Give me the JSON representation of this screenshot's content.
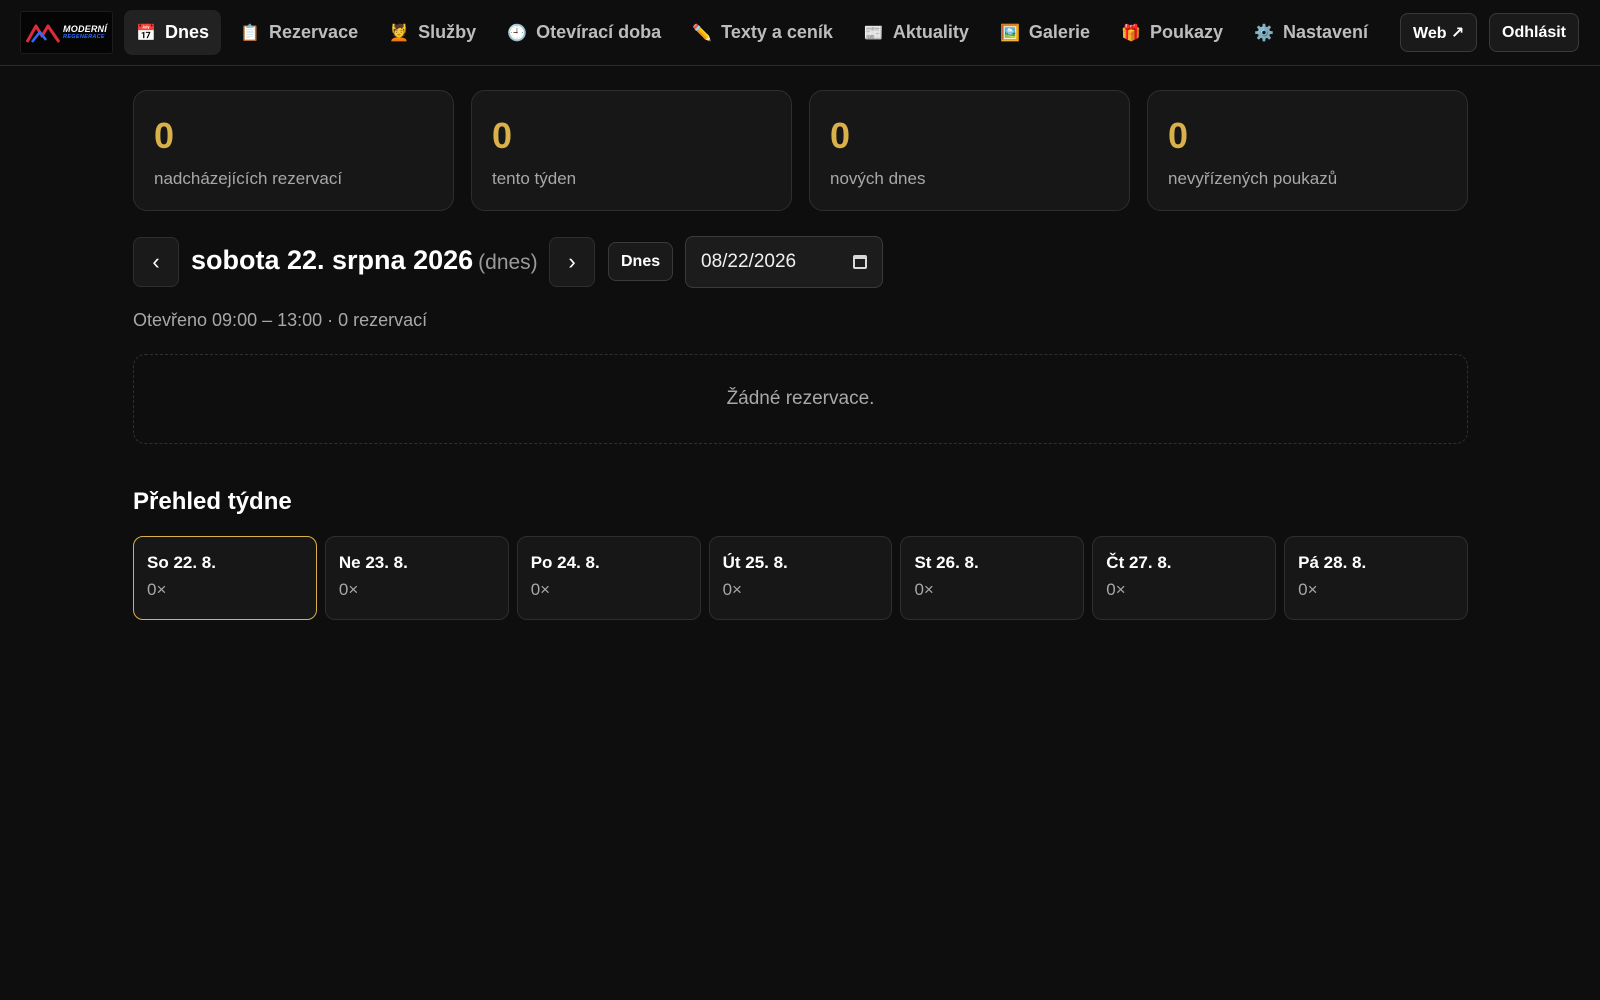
{
  "brand": {
    "logo_line1": "MODERNÍ",
    "logo_line2": "REGENERACE"
  },
  "nav": {
    "items": [
      {
        "icon": "📅",
        "icon_name": "calendar-icon",
        "label": "Dnes",
        "active": true
      },
      {
        "icon": "📋",
        "icon_name": "clipboard-icon",
        "label": "Rezervace",
        "active": false
      },
      {
        "icon": "💆",
        "icon_name": "massage-icon",
        "label": "Služby",
        "active": false
      },
      {
        "icon": "🕘",
        "icon_name": "clock-icon",
        "label": "Otevírací doba",
        "active": false
      },
      {
        "icon": "✏️",
        "icon_name": "pencil-icon",
        "label": "Texty a ceník",
        "active": false
      },
      {
        "icon": "📰",
        "icon_name": "newspaper-icon",
        "label": "Aktuality",
        "active": false
      },
      {
        "icon": "🖼️",
        "icon_name": "picture-icon",
        "label": "Galerie",
        "active": false
      },
      {
        "icon": "🎁",
        "icon_name": "gift-icon",
        "label": "Poukazy",
        "active": false
      },
      {
        "icon": "⚙️",
        "icon_name": "gear-icon",
        "label": "Nastavení",
        "active": false
      }
    ],
    "web_label": "Web ↗",
    "logout_label": "Odhlásit"
  },
  "stats": [
    {
      "value": "0",
      "label": "nadcházejících rezervací"
    },
    {
      "value": "0",
      "label": "tento týden"
    },
    {
      "value": "0",
      "label": "nových dnes"
    },
    {
      "value": "0",
      "label": "nevyřízených poukazů"
    }
  ],
  "date_nav": {
    "prev": "‹",
    "next": "›",
    "title": "sobota 22. srpna 2026",
    "today_suffix": "(dnes)",
    "today_button": "Dnes",
    "date_value": "08/22/2026"
  },
  "open_info": "Otevřeno 09:00 – 13:00 · 0 rezervací",
  "empty_message": "Žádné rezervace.",
  "week": {
    "title": "Přehled týdne",
    "days": [
      {
        "label": "So 22. 8.",
        "count": "0×",
        "active": true
      },
      {
        "label": "Ne 23. 8.",
        "count": "0×",
        "active": false
      },
      {
        "label": "Po 24. 8.",
        "count": "0×",
        "active": false
      },
      {
        "label": "Út 25. 8.",
        "count": "0×",
        "active": false
      },
      {
        "label": "St 26. 8.",
        "count": "0×",
        "active": false
      },
      {
        "label": "Čt 27. 8.",
        "count": "0×",
        "active": false
      },
      {
        "label": "Pá 28. 8.",
        "count": "0×",
        "active": false
      }
    ]
  },
  "colors": {
    "accent": "#d9b04a",
    "background": "#0e0e0e",
    "card": "#171717",
    "brand_blue": "#2f6bff",
    "brand_red": "#e02b3a"
  }
}
